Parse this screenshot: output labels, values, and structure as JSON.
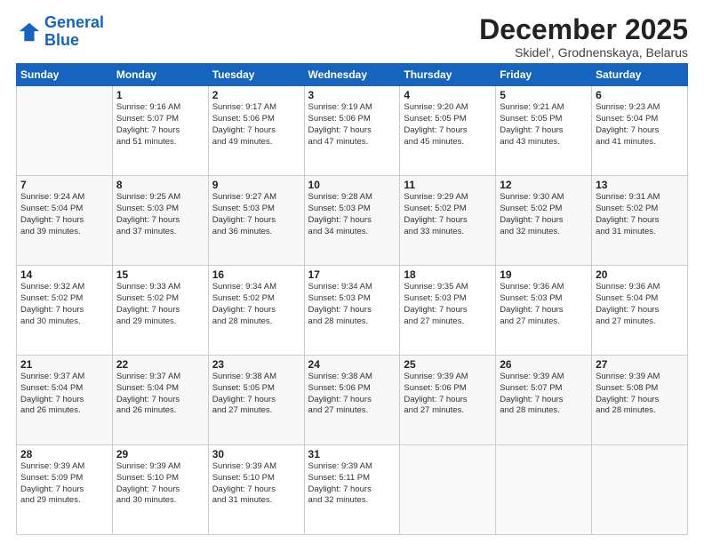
{
  "logo": {
    "line1": "General",
    "line2": "Blue"
  },
  "title": "December 2025",
  "subtitle": "Skidel', Grodnenskaya, Belarus",
  "days_header": [
    "Sunday",
    "Monday",
    "Tuesday",
    "Wednesday",
    "Thursday",
    "Friday",
    "Saturday"
  ],
  "weeks": [
    [
      {
        "day": "",
        "info": ""
      },
      {
        "day": "1",
        "info": "Sunrise: 9:16 AM\nSunset: 5:07 PM\nDaylight: 7 hours\nand 51 minutes."
      },
      {
        "day": "2",
        "info": "Sunrise: 9:17 AM\nSunset: 5:06 PM\nDaylight: 7 hours\nand 49 minutes."
      },
      {
        "day": "3",
        "info": "Sunrise: 9:19 AM\nSunset: 5:06 PM\nDaylight: 7 hours\nand 47 minutes."
      },
      {
        "day": "4",
        "info": "Sunrise: 9:20 AM\nSunset: 5:05 PM\nDaylight: 7 hours\nand 45 minutes."
      },
      {
        "day": "5",
        "info": "Sunrise: 9:21 AM\nSunset: 5:05 PM\nDaylight: 7 hours\nand 43 minutes."
      },
      {
        "day": "6",
        "info": "Sunrise: 9:23 AM\nSunset: 5:04 PM\nDaylight: 7 hours\nand 41 minutes."
      }
    ],
    [
      {
        "day": "7",
        "info": "Sunrise: 9:24 AM\nSunset: 5:04 PM\nDaylight: 7 hours\nand 39 minutes."
      },
      {
        "day": "8",
        "info": "Sunrise: 9:25 AM\nSunset: 5:03 PM\nDaylight: 7 hours\nand 37 minutes."
      },
      {
        "day": "9",
        "info": "Sunrise: 9:27 AM\nSunset: 5:03 PM\nDaylight: 7 hours\nand 36 minutes."
      },
      {
        "day": "10",
        "info": "Sunrise: 9:28 AM\nSunset: 5:03 PM\nDaylight: 7 hours\nand 34 minutes."
      },
      {
        "day": "11",
        "info": "Sunrise: 9:29 AM\nSunset: 5:02 PM\nDaylight: 7 hours\nand 33 minutes."
      },
      {
        "day": "12",
        "info": "Sunrise: 9:30 AM\nSunset: 5:02 PM\nDaylight: 7 hours\nand 32 minutes."
      },
      {
        "day": "13",
        "info": "Sunrise: 9:31 AM\nSunset: 5:02 PM\nDaylight: 7 hours\nand 31 minutes."
      }
    ],
    [
      {
        "day": "14",
        "info": "Sunrise: 9:32 AM\nSunset: 5:02 PM\nDaylight: 7 hours\nand 30 minutes."
      },
      {
        "day": "15",
        "info": "Sunrise: 9:33 AM\nSunset: 5:02 PM\nDaylight: 7 hours\nand 29 minutes."
      },
      {
        "day": "16",
        "info": "Sunrise: 9:34 AM\nSunset: 5:02 PM\nDaylight: 7 hours\nand 28 minutes."
      },
      {
        "day": "17",
        "info": "Sunrise: 9:34 AM\nSunset: 5:03 PM\nDaylight: 7 hours\nand 28 minutes."
      },
      {
        "day": "18",
        "info": "Sunrise: 9:35 AM\nSunset: 5:03 PM\nDaylight: 7 hours\nand 27 minutes."
      },
      {
        "day": "19",
        "info": "Sunrise: 9:36 AM\nSunset: 5:03 PM\nDaylight: 7 hours\nand 27 minutes."
      },
      {
        "day": "20",
        "info": "Sunrise: 9:36 AM\nSunset: 5:04 PM\nDaylight: 7 hours\nand 27 minutes."
      }
    ],
    [
      {
        "day": "21",
        "info": "Sunrise: 9:37 AM\nSunset: 5:04 PM\nDaylight: 7 hours\nand 26 minutes."
      },
      {
        "day": "22",
        "info": "Sunrise: 9:37 AM\nSunset: 5:04 PM\nDaylight: 7 hours\nand 26 minutes."
      },
      {
        "day": "23",
        "info": "Sunrise: 9:38 AM\nSunset: 5:05 PM\nDaylight: 7 hours\nand 27 minutes."
      },
      {
        "day": "24",
        "info": "Sunrise: 9:38 AM\nSunset: 5:06 PM\nDaylight: 7 hours\nand 27 minutes."
      },
      {
        "day": "25",
        "info": "Sunrise: 9:39 AM\nSunset: 5:06 PM\nDaylight: 7 hours\nand 27 minutes."
      },
      {
        "day": "26",
        "info": "Sunrise: 9:39 AM\nSunset: 5:07 PM\nDaylight: 7 hours\nand 28 minutes."
      },
      {
        "day": "27",
        "info": "Sunrise: 9:39 AM\nSunset: 5:08 PM\nDaylight: 7 hours\nand 28 minutes."
      }
    ],
    [
      {
        "day": "28",
        "info": "Sunrise: 9:39 AM\nSunset: 5:09 PM\nDaylight: 7 hours\nand 29 minutes."
      },
      {
        "day": "29",
        "info": "Sunrise: 9:39 AM\nSunset: 5:10 PM\nDaylight: 7 hours\nand 30 minutes."
      },
      {
        "day": "30",
        "info": "Sunrise: 9:39 AM\nSunset: 5:10 PM\nDaylight: 7 hours\nand 31 minutes."
      },
      {
        "day": "31",
        "info": "Sunrise: 9:39 AM\nSunset: 5:11 PM\nDaylight: 7 hours\nand 32 minutes."
      },
      {
        "day": "",
        "info": ""
      },
      {
        "day": "",
        "info": ""
      },
      {
        "day": "",
        "info": ""
      }
    ]
  ]
}
